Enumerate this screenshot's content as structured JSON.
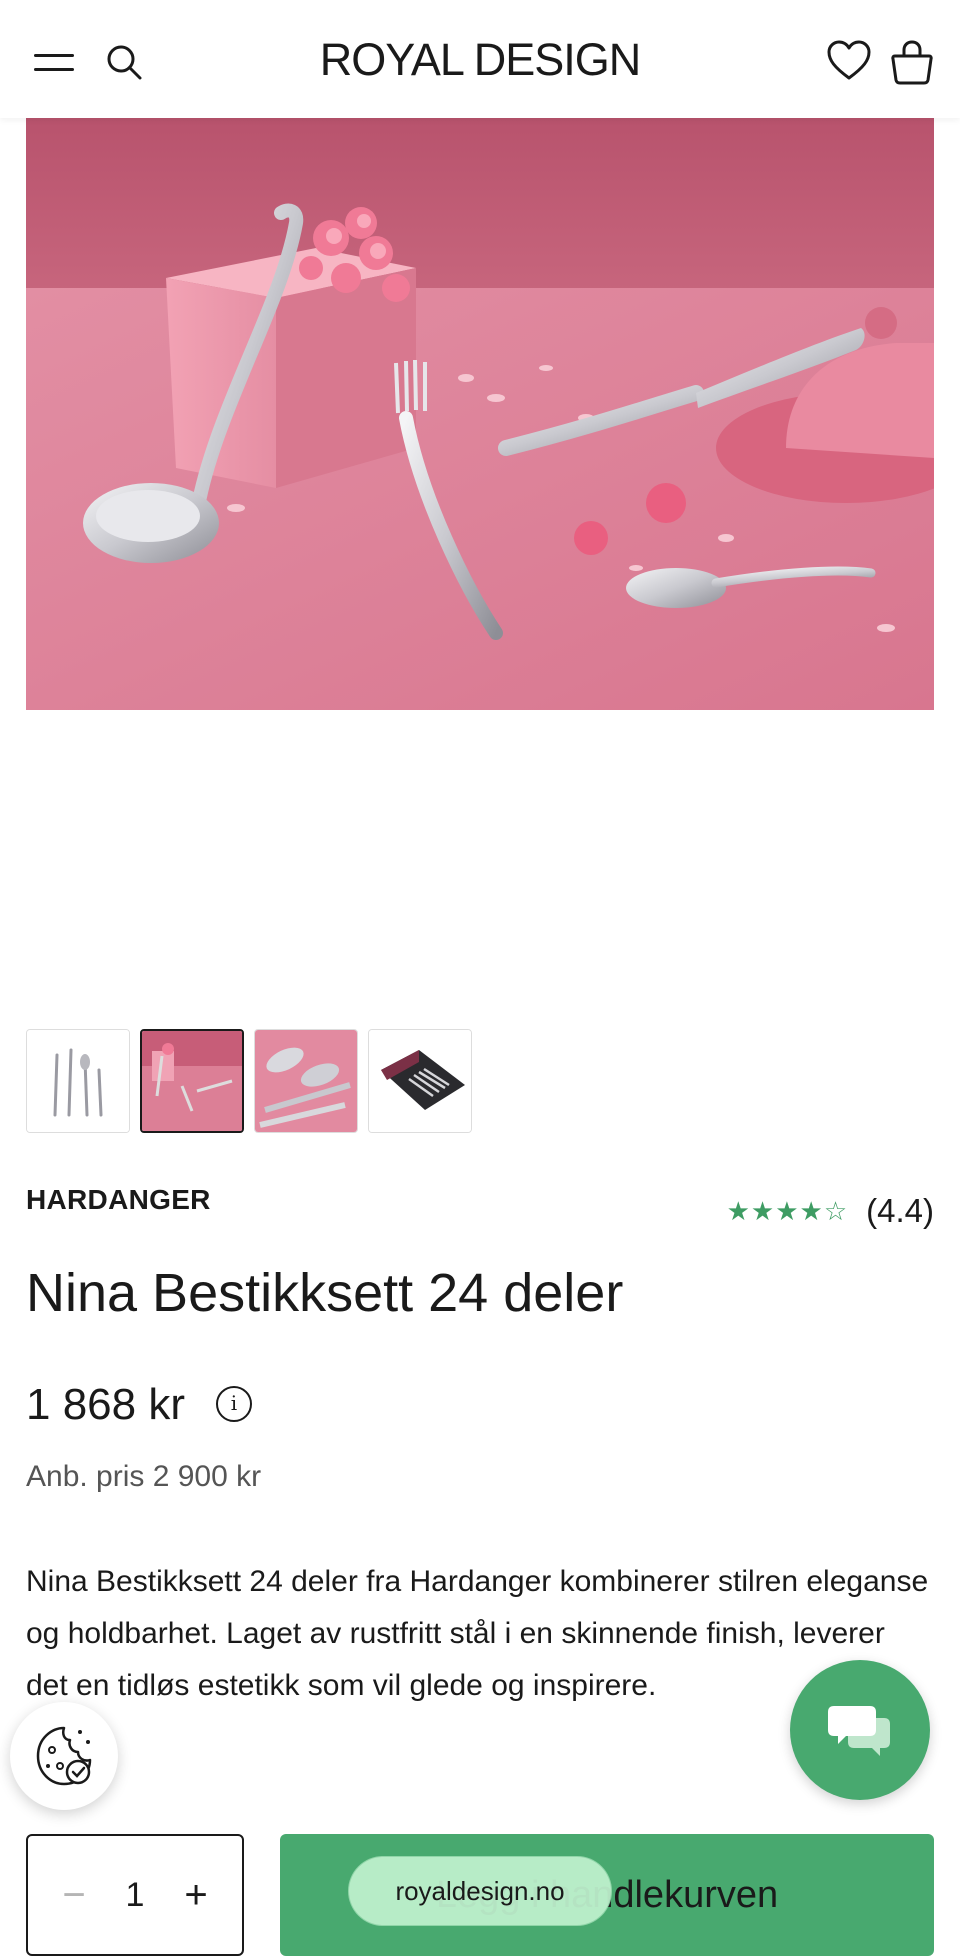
{
  "header": {
    "logo": "ROYAL DESIGN",
    "menu_icon": "hamburger-menu-icon",
    "search_icon": "search-icon",
    "wishlist_icon": "heart-icon",
    "cart_icon": "shopping-bag-icon"
  },
  "gallery": {
    "hero_icon": "product-image-pink-cutlery",
    "thumbnails": [
      "cutlery-white-background",
      "cutlery-pink-scene",
      "spoons-closeup-pink",
      "cutlery-gift-box"
    ],
    "active_thumbnail": 1
  },
  "product": {
    "brand": "HARDANGER",
    "stars": "★★★★☆",
    "rating": 4.4,
    "rating_text": "(4.4)",
    "title": "Nina Bestikksett 24 deler",
    "price": "1 868 kr",
    "info_glyph": "i",
    "rrp": "Anb. pris 2 900 kr",
    "description": "Nina Bestikksett 24 deler fra Hardanger kombinerer stilren eleganse og holdbarhet. Laget av rustfritt stål i en skinnende finish, leverer det en tidløs estetikk som vil glede og inspirere."
  },
  "purchase": {
    "quantity": "1",
    "minus": "−",
    "plus": "+",
    "add_to_cart": "Legg i handlekurven"
  },
  "overlays": {
    "chat_icon": "chat-bubbles-icon",
    "cookie_icon": "cookie-settings-icon",
    "url": "royaldesign.no"
  },
  "colors": {
    "accent_green": "#48a96f",
    "star_green": "#3e9c63",
    "hero_pink": "#c85f7a"
  }
}
